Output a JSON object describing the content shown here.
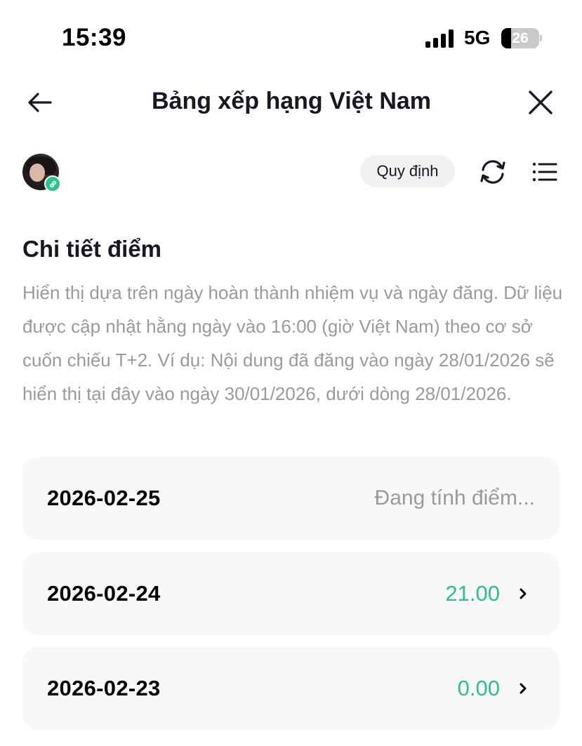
{
  "status_bar": {
    "time": "15:39",
    "network": "5G",
    "battery_level": "26",
    "icons": [
      "signal-bars-icon",
      "battery-icon"
    ]
  },
  "header": {
    "title": "Bảng xếp hạng Việt Nam",
    "back_icon": "arrow-left-icon",
    "close_icon": "close-icon"
  },
  "toolbar": {
    "rules_label": "Quy định",
    "refresh_icon": "refresh-icon",
    "menu_icon": "list-menu-icon",
    "avatar_badge_icon": "link-icon",
    "badge_color": "#2bc58b"
  },
  "section": {
    "title": "Chi tiết điểm",
    "description": "Hiển thị dựa trên ngày hoàn thành nhiệm vụ và ngày đăng. Dữ liệu được cập nhật hằng ngày vào 16:00 (giờ Việt Nam) theo cơ sở cuốn chiếu T+2. Ví dụ: Nội dung đã đăng vào ngày 28/01/2026 sẽ hiển thị tại đây vào ngày 30/01/2026, dưới dòng 28/01/2026."
  },
  "rows": [
    {
      "date": "2026-02-25",
      "value": "Đang tính điểm...",
      "pending": true
    },
    {
      "date": "2026-02-24",
      "value": "21.00",
      "pending": false
    },
    {
      "date": "2026-02-23",
      "value": "0.00",
      "pending": false
    }
  ],
  "colors": {
    "score_green": "#2bbf8a",
    "muted_text": "#9a9a9e",
    "row_bg": "#f8f8f8"
  }
}
